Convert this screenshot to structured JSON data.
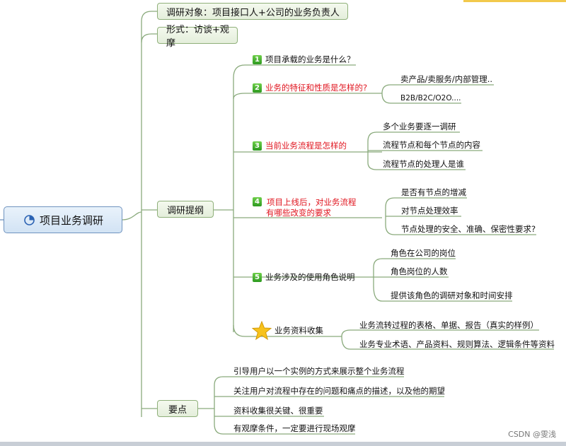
{
  "root": {
    "label": "项目业务调研",
    "icon": "pie-chart-icon"
  },
  "branches": {
    "target": "调研对象：项目接口人+公司的业务负责人",
    "form": "形式：访谈+观摩",
    "outline": "调研提纲",
    "points": "要点"
  },
  "outline_items": [
    {
      "num": "1",
      "label": "项目承载的业务是什么？",
      "children": []
    },
    {
      "num": "2",
      "label": "业务的特征和性质是怎样的?",
      "children": [
        "卖产品/卖服务/内部管理..",
        "B2B/B2C/O2O...."
      ]
    },
    {
      "num": "3",
      "label": "当前业务流程是怎样的",
      "children": [
        "多个业务要逐一调研",
        "流程节点和每个节点的内容",
        "流程节点的处理人是谁"
      ]
    },
    {
      "num": "4",
      "label_line1": "项目上线后，对业务流程",
      "label_line2": "有哪些改变的要求",
      "children": [
        "是否有节点的增减",
        "对节点处理效率",
        "节点处理的安全、准确、保密性要求?"
      ]
    },
    {
      "num": "5",
      "label": "业务涉及的使用角色说明",
      "children": [
        "角色在公司的岗位",
        "角色岗位的人数",
        "提供该角色的调研对象和时间安排"
      ]
    },
    {
      "icon": "star-icon",
      "label": "业务资料收集",
      "children": [
        "业务流转过程的表格、单据、报告（真实的样例）",
        "业务专业术语、产品资料、规则算法、逻辑条件等资料"
      ]
    }
  ],
  "points": [
    "引导用户以一个实例的方式来展示整个业务流程",
    "关注用户对流程中存在的问题和痛点的描述，以及他的期望",
    "资料收集很关键、很重要",
    "有观摩条件，一定要进行现场观摩"
  ],
  "watermark": "CSDN @雯浅",
  "colors": {
    "line": "#7aa36a",
    "red_text": "#e0141e",
    "root_border": "#6f93bf"
  }
}
